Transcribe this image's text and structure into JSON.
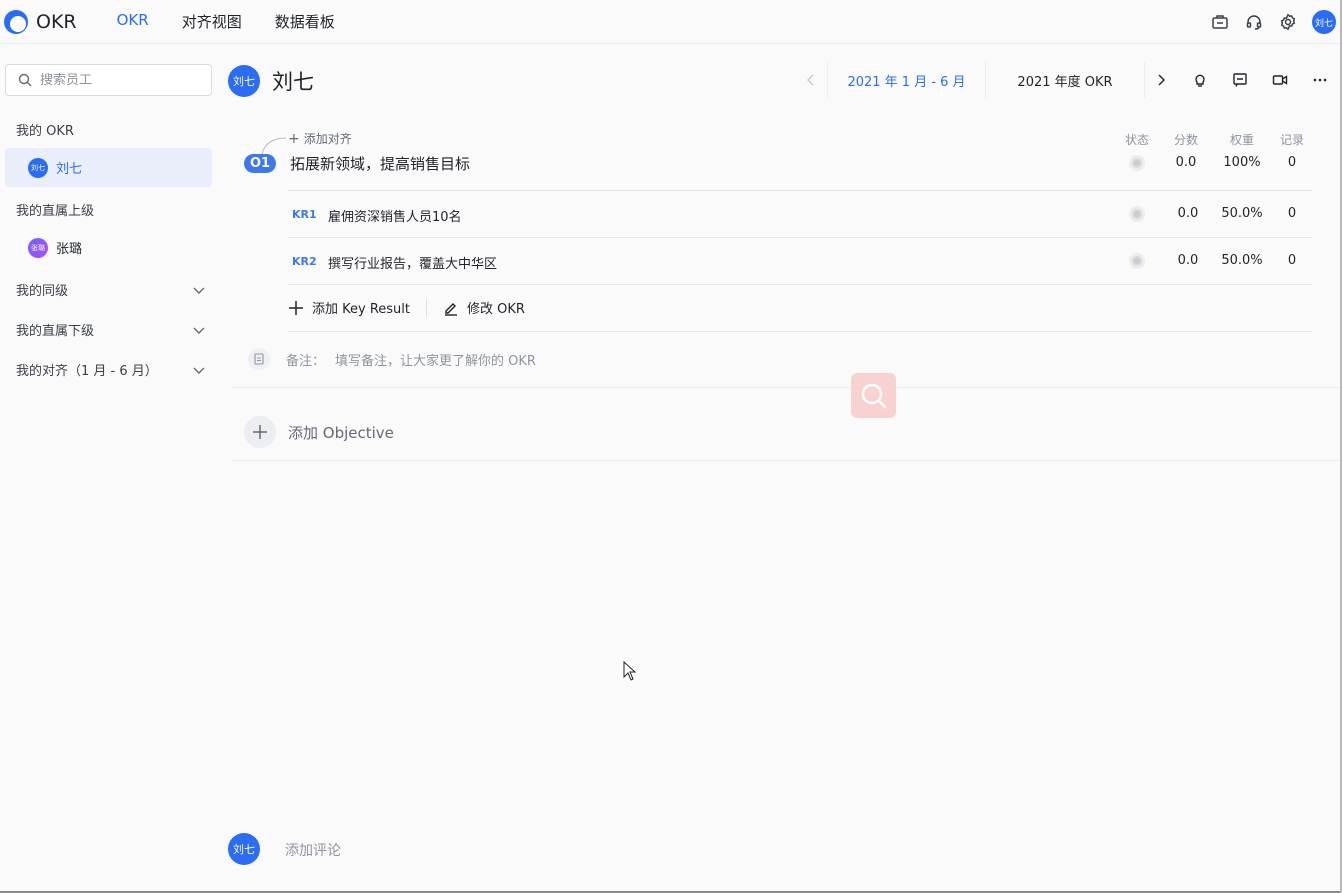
{
  "app": {
    "name": "OKR"
  },
  "nav": {
    "tabs": [
      {
        "label": "OKR"
      },
      {
        "label": "对齐视图"
      },
      {
        "label": "数据看板"
      }
    ]
  },
  "user": {
    "avatar_text": "刘七"
  },
  "sidebar": {
    "search_placeholder": "搜索员工",
    "my_okr": {
      "label": "我的 OKR",
      "person": {
        "avatar_text": "刘七",
        "name": "刘七"
      }
    },
    "supervisor": {
      "label": "我的直属上级",
      "person": {
        "avatar_text": "张璐",
        "name": "张璐"
      }
    },
    "peers": {
      "label": "我的同级"
    },
    "subordinates": {
      "label": "我的直属下级"
    },
    "aligned": {
      "label": "我的对齐（1 月 - 6 月）"
    }
  },
  "header": {
    "avatar_text": "刘七",
    "name": "刘七",
    "periods": [
      {
        "label": "2021 年 1 月 - 6 月"
      },
      {
        "label": "2021 年度 OKR"
      }
    ]
  },
  "columns": {
    "status": "状态",
    "score": "分数",
    "weight": "权重",
    "records": "记录"
  },
  "objective": {
    "add_align": "添加对齐",
    "badge": "O1",
    "title": "拓展新领域，提高销售目标",
    "score": "0.0",
    "weight": "100%",
    "records": "0",
    "key_results": [
      {
        "tag": "KR1",
        "title": "雇佣资深销售人员10名",
        "score": "0.0",
        "weight": "50.0%",
        "records": "0"
      },
      {
        "tag": "KR2",
        "title": "撰写行业报告，覆盖大中华区",
        "score": "0.0",
        "weight": "50.0%",
        "records": "0"
      }
    ],
    "add_kr": "添加 Key Result",
    "edit_okr": "修改 OKR",
    "note_label": "备注：",
    "note_placeholder": "填写备注，让大家更了解你的 OKR"
  },
  "add_objective": "添加 Objective",
  "comment": {
    "avatar_text": "刘七",
    "placeholder": "添加评论"
  },
  "colors": {
    "accent": "#2b6cf5",
    "objective_badge": "#3f78ec",
    "supervisor_avatar": "#8b5cf6"
  }
}
